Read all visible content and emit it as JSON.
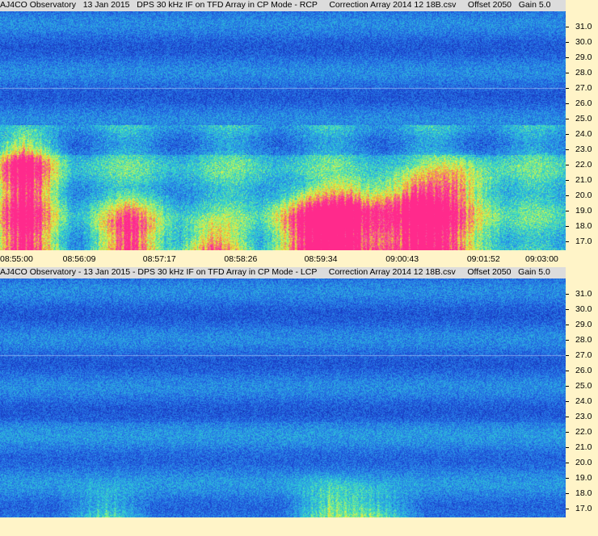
{
  "panels": [
    {
      "title": "AJ4CO Observatory   13 Jan 2015   DPS 30 kHz IF on TFD Array in CP Mode - RCP     Correction Array 2014 12 18B.csv     Offset 2050   Gain 5.0",
      "polarization": "RCP",
      "time_ticks": [
        "08:55:00",
        "08:56:09",
        "08:57:17",
        "08:58:26",
        "08:59:34",
        "09:00:43",
        "09:01:52",
        "09:03:00"
      ]
    },
    {
      "title": "AJ4CO Observatory - 13 Jan 2015 - DPS 30 kHz IF on TFD Array in CP Mode - LCP     Correction Array 2014 12 18B.csv     Offset 2050   Gain 5.0",
      "polarization": "LCP",
      "time_ticks": []
    }
  ],
  "freq_ticks": [
    "31.0",
    "30.0",
    "29.0",
    "28.0",
    "27.0",
    "26.0",
    "25.0",
    "24.0",
    "23.0",
    "22.0",
    "21.0",
    "20.0",
    "19.0",
    "18.0",
    "17.0"
  ],
  "colors": {
    "background": "#fff4c8",
    "title_bg": "#dcdcdc",
    "colormap": [
      "#0a1a8c",
      "#1f4fd8",
      "#2a8fe8",
      "#2fd3d0",
      "#8cf07a",
      "#e8f046",
      "#f0b030",
      "#f05aa0",
      "#ff2a8c"
    ]
  },
  "chart_data": [
    {
      "type": "heatmap",
      "title": "AJ4CO Observatory   13 Jan 2015   DPS 30 kHz IF on TFD Array in CP Mode - RCP     Correction Array 2014 12 18B.csv     Offset 2050   Gain 5.0",
      "x": [
        "08:55:00",
        "08:56:09",
        "08:57:17",
        "08:58:26",
        "08:59:34",
        "09:00:43",
        "09:01:52",
        "09:03:00"
      ],
      "x_range": [
        "08:55:00",
        "09:03:00"
      ],
      "y_range": [
        16.4,
        32.0
      ],
      "yticks": [
        17,
        18,
        19,
        20,
        21,
        22,
        23,
        24,
        25,
        26,
        27,
        28,
        29,
        30,
        31
      ],
      "xlabel": "",
      "ylabel": "",
      "grid": false,
      "intensity_note": "low",
      "bursts": [
        {
          "t": "08:55:20",
          "f_low": 16.4,
          "f_high": 24.5,
          "level": 0.8
        },
        {
          "t": "08:56:50",
          "f_low": 16.4,
          "f_high": 20.5,
          "level": 0.7
        },
        {
          "t": "08:58:00",
          "f_low": 16.4,
          "f_high": 19.0,
          "level": 0.65
        },
        {
          "t": "08:59:20",
          "f_low": 16.4,
          "f_high": 21.0,
          "level": 0.9
        },
        {
          "t": "09:00:00",
          "f_low": 16.4,
          "f_high": 21.5,
          "level": 0.95
        },
        {
          "t": "09:00:50",
          "f_low": 16.4,
          "f_high": 22.0,
          "level": 0.95
        },
        {
          "t": "09:01:30",
          "f_low": 16.4,
          "f_high": 23.0,
          "level": 0.6
        }
      ]
    },
    {
      "type": "heatmap",
      "title": "AJ4CO Observatory - 13 Jan 2015 - DPS 30 kHz IF on TFD Array in CP Mode - LCP     Correction Array 2014 12 18B.csv     Offset 2050   Gain 5.0",
      "x_range": [
        "08:55:00",
        "09:03:00"
      ],
      "y_range": [
        16.4,
        32.0
      ],
      "yticks": [
        17,
        18,
        19,
        20,
        21,
        22,
        23,
        24,
        25,
        26,
        27,
        28,
        29,
        30,
        31
      ],
      "xlabel": "",
      "ylabel": "",
      "grid": false,
      "bursts": [
        {
          "t": "08:56:30",
          "f_low": 16.4,
          "f_high": 19.0,
          "level": 0.35
        },
        {
          "t": "08:59:40",
          "f_low": 16.4,
          "f_high": 19.5,
          "level": 0.45
        },
        {
          "t": "09:00:20",
          "f_low": 16.4,
          "f_high": 19.0,
          "level": 0.4
        }
      ]
    }
  ]
}
